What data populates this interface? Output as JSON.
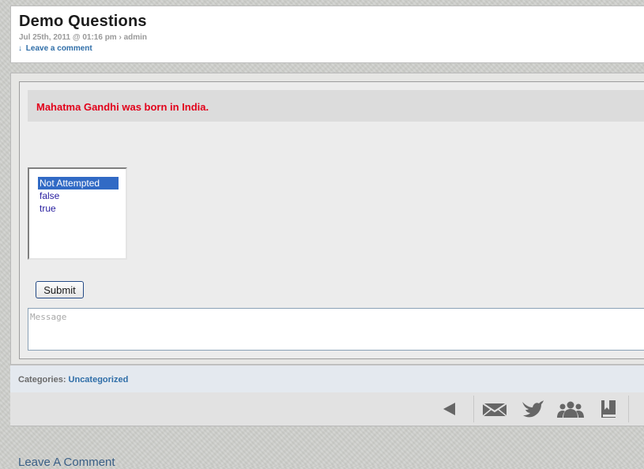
{
  "post": {
    "title": "Demo Questions",
    "meta": "Jul 25th, 2011 @ 01:16 pm › admin",
    "comment_arrow": "↓",
    "comment_link": "Leave a comment"
  },
  "quiz": {
    "question": "Mahatma Gandhi was born in India.",
    "options": [
      "Not Attempted",
      "false",
      "true"
    ],
    "selected": "Not Attempted",
    "submit_label": "Submit",
    "message_placeholder": "Message"
  },
  "categories": {
    "label": "Categories:",
    "link": "Uncategorized"
  },
  "share_icons": [
    "back-arrow-icon",
    "email-icon",
    "twitter-bird-icon",
    "group-people-icon",
    "bookmark-icon"
  ],
  "colors": {
    "question_text": "#e2001a",
    "link": "#2f6ea8",
    "selected_option_bg": "#316ac5",
    "icon": "#666666"
  },
  "footer": {
    "heading": "Leave A Comment"
  }
}
